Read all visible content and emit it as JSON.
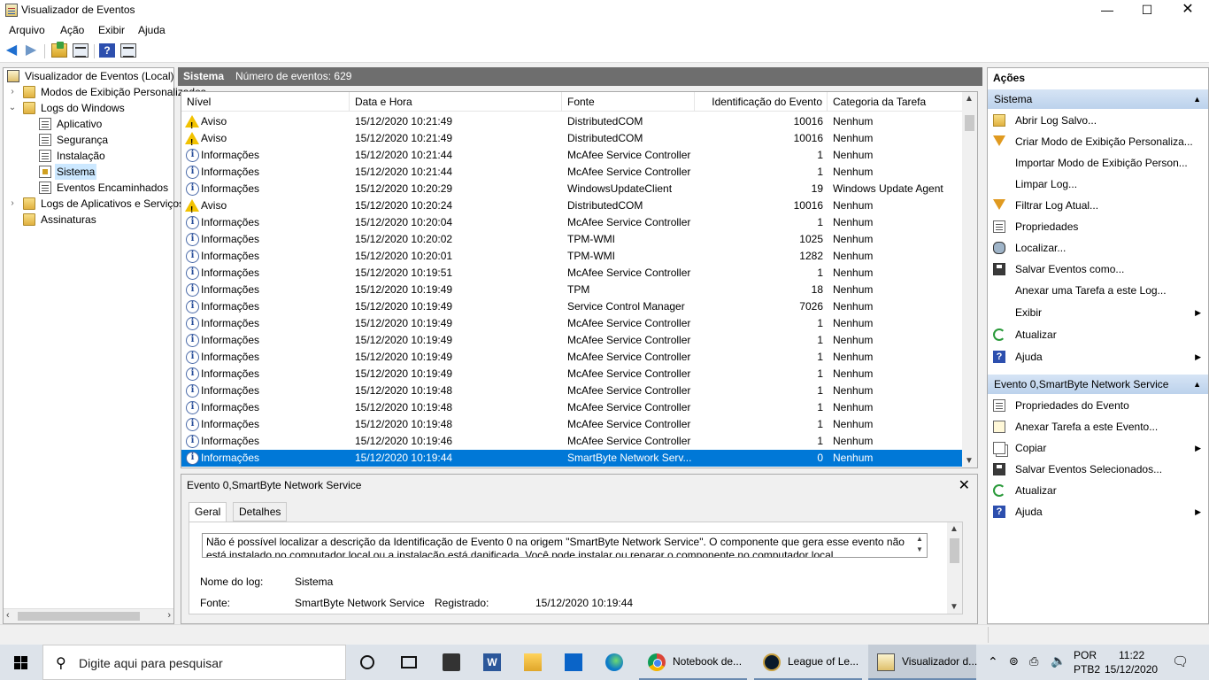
{
  "window": {
    "title": "Visualizador de Eventos",
    "min": "—",
    "max": "☐",
    "close": "✕"
  },
  "menu": [
    "Arquivo",
    "Ação",
    "Exibir",
    "Ajuda"
  ],
  "tree": {
    "root": "Visualizador de Eventos (Local)",
    "items": [
      {
        "label": "Modos de Exibição Personalizados",
        "chev": "›"
      },
      {
        "label": "Logs do Windows",
        "chev": "⌄"
      },
      {
        "label": "Aplicativo"
      },
      {
        "label": "Segurança"
      },
      {
        "label": "Instalação"
      },
      {
        "label": "Sistema"
      },
      {
        "label": "Eventos Encaminhados"
      },
      {
        "label": "Logs de Aplicativos e Serviços",
        "chev": "›"
      },
      {
        "label": "Assinaturas"
      }
    ]
  },
  "center": {
    "log_name": "Sistema",
    "event_count": "Número de eventos: 629"
  },
  "grid": {
    "columns": [
      "Nível",
      "Data e Hora",
      "Fonte",
      "Identificação do Evento",
      "Categoria da Tarefa"
    ],
    "rows": [
      {
        "type": "warn",
        "level": "Aviso",
        "date": "15/12/2020 10:21:49",
        "source": "DistributedCOM",
        "id": "10016",
        "cat": "Nenhum"
      },
      {
        "type": "warn",
        "level": "Aviso",
        "date": "15/12/2020 10:21:49",
        "source": "DistributedCOM",
        "id": "10016",
        "cat": "Nenhum"
      },
      {
        "type": "info",
        "level": "Informações",
        "date": "15/12/2020 10:21:44",
        "source": "McAfee Service Controller",
        "id": "1",
        "cat": "Nenhum"
      },
      {
        "type": "info",
        "level": "Informações",
        "date": "15/12/2020 10:21:44",
        "source": "McAfee Service Controller",
        "id": "1",
        "cat": "Nenhum"
      },
      {
        "type": "info",
        "level": "Informações",
        "date": "15/12/2020 10:20:29",
        "source": "WindowsUpdateClient",
        "id": "19",
        "cat": "Windows Update Agent"
      },
      {
        "type": "warn",
        "level": "Aviso",
        "date": "15/12/2020 10:20:24",
        "source": "DistributedCOM",
        "id": "10016",
        "cat": "Nenhum"
      },
      {
        "type": "info",
        "level": "Informações",
        "date": "15/12/2020 10:20:04",
        "source": "McAfee Service Controller",
        "id": "1",
        "cat": "Nenhum"
      },
      {
        "type": "info",
        "level": "Informações",
        "date": "15/12/2020 10:20:02",
        "source": "TPM-WMI",
        "id": "1025",
        "cat": "Nenhum"
      },
      {
        "type": "info",
        "level": "Informações",
        "date": "15/12/2020 10:20:01",
        "source": "TPM-WMI",
        "id": "1282",
        "cat": "Nenhum"
      },
      {
        "type": "info",
        "level": "Informações",
        "date": "15/12/2020 10:19:51",
        "source": "McAfee Service Controller",
        "id": "1",
        "cat": "Nenhum"
      },
      {
        "type": "info",
        "level": "Informações",
        "date": "15/12/2020 10:19:49",
        "source": "TPM",
        "id": "18",
        "cat": "Nenhum"
      },
      {
        "type": "info",
        "level": "Informações",
        "date": "15/12/2020 10:19:49",
        "source": "Service Control Manager",
        "id": "7026",
        "cat": "Nenhum"
      },
      {
        "type": "info",
        "level": "Informações",
        "date": "15/12/2020 10:19:49",
        "source": "McAfee Service Controller",
        "id": "1",
        "cat": "Nenhum"
      },
      {
        "type": "info",
        "level": "Informações",
        "date": "15/12/2020 10:19:49",
        "source": "McAfee Service Controller",
        "id": "1",
        "cat": "Nenhum"
      },
      {
        "type": "info",
        "level": "Informações",
        "date": "15/12/2020 10:19:49",
        "source": "McAfee Service Controller",
        "id": "1",
        "cat": "Nenhum"
      },
      {
        "type": "info",
        "level": "Informações",
        "date": "15/12/2020 10:19:49",
        "source": "McAfee Service Controller",
        "id": "1",
        "cat": "Nenhum"
      },
      {
        "type": "info",
        "level": "Informações",
        "date": "15/12/2020 10:19:48",
        "source": "McAfee Service Controller",
        "id": "1",
        "cat": "Nenhum"
      },
      {
        "type": "info",
        "level": "Informações",
        "date": "15/12/2020 10:19:48",
        "source": "McAfee Service Controller",
        "id": "1",
        "cat": "Nenhum"
      },
      {
        "type": "info",
        "level": "Informações",
        "date": "15/12/2020 10:19:48",
        "source": "McAfee Service Controller",
        "id": "1",
        "cat": "Nenhum"
      },
      {
        "type": "info",
        "level": "Informações",
        "date": "15/12/2020 10:19:46",
        "source": "McAfee Service Controller",
        "id": "1",
        "cat": "Nenhum"
      },
      {
        "type": "info",
        "level": "Informações",
        "date": "15/12/2020 10:19:44",
        "source": "SmartByte Network Serv...",
        "id": "0",
        "cat": "Nenhum",
        "selected": true
      }
    ]
  },
  "detail": {
    "title": "Evento 0,SmartByte Network Service",
    "close": "✕",
    "tabs": [
      "Geral",
      "Detalhes"
    ],
    "description": "Não é possível localizar a descrição da Identificação de Evento 0 na origem \"SmartByte Network Service\". O componente que gera esse evento não está instalado no computador local ou a instalação está danificada. Você pode instalar ou reparar o componente no computador local.",
    "log_name_label": "Nome do log:",
    "log_name_value": "Sistema",
    "source_label": "Fonte:",
    "source_value": "SmartByte Network Service",
    "registered_label": "Registrado:",
    "registered_value": "15/12/2020 10:19:44"
  },
  "actions": {
    "title": "Ações",
    "section1": "Sistema",
    "items1": [
      {
        "label": "Abrir Log Salvo...",
        "icon": "open-folder-icon"
      },
      {
        "label": "Criar Modo de Exibição Personaliza...",
        "icon": "filter-icon"
      },
      {
        "label": "Importar Modo de Exibição Person...",
        "icon": ""
      },
      {
        "label": "Limpar Log...",
        "icon": ""
      },
      {
        "label": "Filtrar Log Atual...",
        "icon": "filter-icon"
      },
      {
        "label": "Propriedades",
        "icon": "properties-icon"
      },
      {
        "label": "Localizar...",
        "icon": "find-icon"
      },
      {
        "label": "Salvar Eventos como...",
        "icon": "save-icon"
      },
      {
        "label": "Anexar uma Tarefa a este Log...",
        "icon": ""
      },
      {
        "label": "Exibir",
        "icon": "",
        "submenu": true
      },
      {
        "label": "Atualizar",
        "icon": "refresh-icon"
      },
      {
        "label": "Ajuda",
        "icon": "help-icon",
        "submenu": true
      }
    ],
    "section2": "Evento 0,SmartByte Network Service",
    "items2": [
      {
        "label": "Propriedades do Evento",
        "icon": "properties-icon"
      },
      {
        "label": "Anexar Tarefa a este Evento...",
        "icon": "task-icon"
      },
      {
        "label": "Copiar",
        "icon": "copy-icon",
        "submenu": true
      },
      {
        "label": "Salvar Eventos Selecionados...",
        "icon": "save-icon"
      },
      {
        "label": "Atualizar",
        "icon": "refresh-icon"
      },
      {
        "label": "Ajuda",
        "icon": "help-icon",
        "submenu": true
      }
    ]
  },
  "taskbar": {
    "search_placeholder": "Digite aqui para pesquisar",
    "apps": [
      {
        "label": "Notebook de...",
        "icon": "chrome-icon"
      },
      {
        "label": "League of Le...",
        "icon": "league-icon"
      },
      {
        "label": "Visualizador d...",
        "icon": "event-viewer-icon"
      }
    ],
    "lang1": "POR",
    "lang2": "PTB2",
    "time": "11:22",
    "date": "15/12/2020"
  }
}
